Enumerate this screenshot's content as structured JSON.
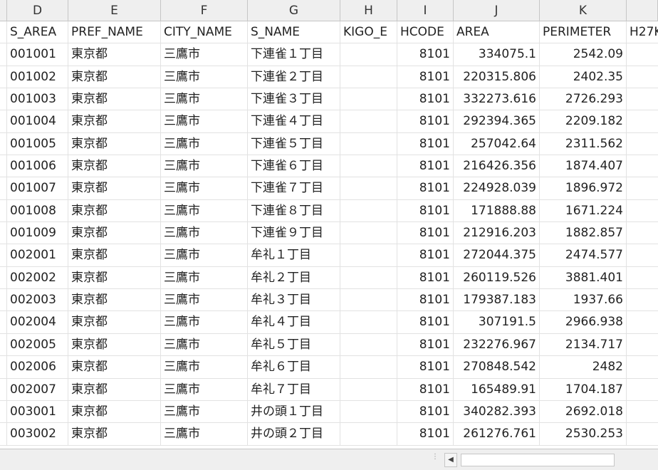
{
  "columns": [
    "",
    "D",
    "E",
    "F",
    "G",
    "H",
    "I",
    "J",
    "K",
    ""
  ],
  "header_row": [
    "",
    "S_AREA",
    "PREF_NAME",
    "CITY_NAME",
    "S_NAME",
    "KIGO_E",
    "HCODE",
    "AREA",
    "PERIMETER",
    "H27K"
  ],
  "rows": [
    [
      "",
      "001001",
      "東京都",
      "三鷹市",
      "下連雀１丁目",
      "",
      "8101",
      "334075.1",
      "2542.09",
      ""
    ],
    [
      "",
      "001002",
      "東京都",
      "三鷹市",
      "下連雀２丁目",
      "",
      "8101",
      "220315.806",
      "2402.35",
      ""
    ],
    [
      "",
      "001003",
      "東京都",
      "三鷹市",
      "下連雀３丁目",
      "",
      "8101",
      "332273.616",
      "2726.293",
      ""
    ],
    [
      "",
      "001004",
      "東京都",
      "三鷹市",
      "下連雀４丁目",
      "",
      "8101",
      "292394.365",
      "2209.182",
      ""
    ],
    [
      "",
      "001005",
      "東京都",
      "三鷹市",
      "下連雀５丁目",
      "",
      "8101",
      "257042.64",
      "2311.562",
      ""
    ],
    [
      "",
      "001006",
      "東京都",
      "三鷹市",
      "下連雀６丁目",
      "",
      "8101",
      "216426.356",
      "1874.407",
      ""
    ],
    [
      "",
      "001007",
      "東京都",
      "三鷹市",
      "下連雀７丁目",
      "",
      "8101",
      "224928.039",
      "1896.972",
      ""
    ],
    [
      "",
      "001008",
      "東京都",
      "三鷹市",
      "下連雀８丁目",
      "",
      "8101",
      "171888.88",
      "1671.224",
      ""
    ],
    [
      "",
      "001009",
      "東京都",
      "三鷹市",
      "下連雀９丁目",
      "",
      "8101",
      "212916.203",
      "1882.857",
      ""
    ],
    [
      "",
      "002001",
      "東京都",
      "三鷹市",
      "牟礼１丁目",
      "",
      "8101",
      "272044.375",
      "2474.577",
      ""
    ],
    [
      "",
      "002002",
      "東京都",
      "三鷹市",
      "牟礼２丁目",
      "",
      "8101",
      "260119.526",
      "3881.401",
      ""
    ],
    [
      "",
      "002003",
      "東京都",
      "三鷹市",
      "牟礼３丁目",
      "",
      "8101",
      "179387.183",
      "1937.66",
      ""
    ],
    [
      "",
      "002004",
      "東京都",
      "三鷹市",
      "牟礼４丁目",
      "",
      "8101",
      "307191.5",
      "2966.938",
      ""
    ],
    [
      "",
      "002005",
      "東京都",
      "三鷹市",
      "牟礼５丁目",
      "",
      "8101",
      "232276.967",
      "2134.717",
      ""
    ],
    [
      "",
      "002006",
      "東京都",
      "三鷹市",
      "牟礼６丁目",
      "",
      "8101",
      "270848.542",
      "2482",
      ""
    ],
    [
      "",
      "002007",
      "東京都",
      "三鷹市",
      "牟礼７丁目",
      "",
      "8101",
      "165489.91",
      "1704.187",
      ""
    ],
    [
      "",
      "003001",
      "東京都",
      "三鷹市",
      "井の頭１丁目",
      "",
      "8101",
      "340282.393",
      "2692.018",
      ""
    ],
    [
      "",
      "003002",
      "東京都",
      "三鷹市",
      "井の頭２丁目",
      "",
      "8101",
      "261276.761",
      "2530.253",
      ""
    ]
  ],
  "icons": {
    "scroll_left": "arrow-left-icon",
    "resize_grip": "grip-icon"
  }
}
